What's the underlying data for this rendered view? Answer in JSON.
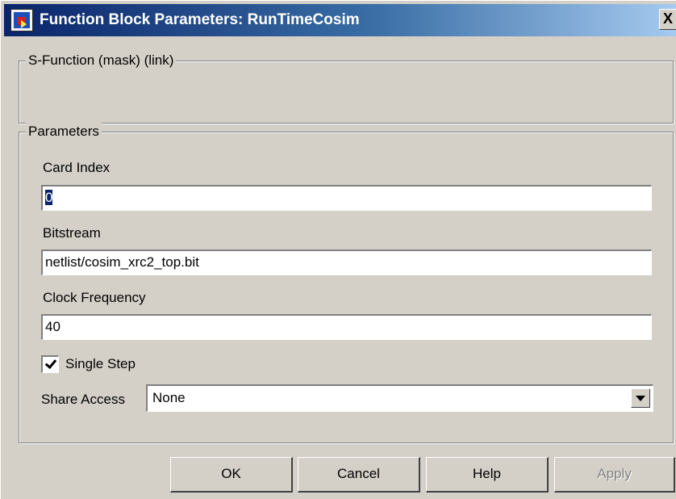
{
  "window": {
    "title": "Function Block Parameters: RunTimeCosim",
    "close_symbol": "X"
  },
  "sections": {
    "description": {
      "title": "S-Function (mask) (link)"
    },
    "parameters": {
      "title": "Parameters"
    }
  },
  "params": {
    "card_index": {
      "label": "Card Index",
      "value": "0"
    },
    "bitstream": {
      "label": "Bitstream",
      "value": "netlist/cosim_xrc2_top.bit"
    },
    "clock_frequency": {
      "label": "Clock Frequency",
      "value": "40"
    },
    "single_step": {
      "label": "Single Step",
      "checked": true
    },
    "share_access": {
      "label": "Share Access",
      "value": "None"
    }
  },
  "buttons": {
    "ok": "OK",
    "cancel": "Cancel",
    "help": "Help",
    "apply": "Apply"
  }
}
